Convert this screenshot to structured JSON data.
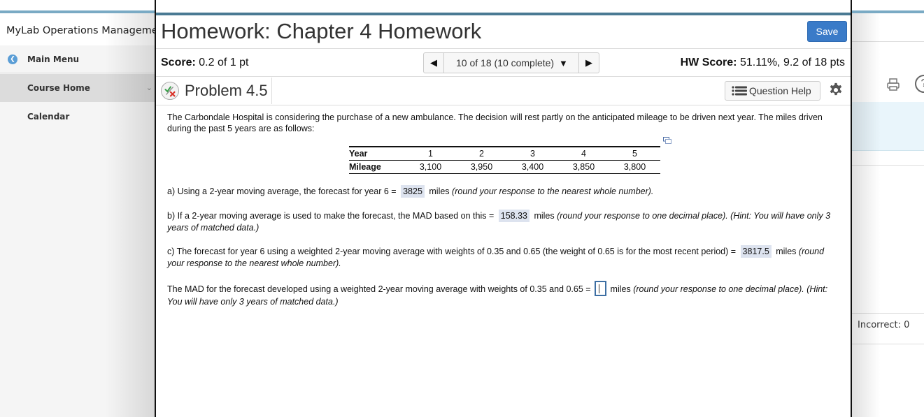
{
  "background": {
    "brand": "MyLab Operations Management",
    "sidebar": {
      "items": [
        {
          "label": "Main Menu",
          "icon": "back-circle-icon"
        },
        {
          "label": "Course Home",
          "icon": "chevron-down-icon"
        },
        {
          "label": "Calendar"
        }
      ]
    },
    "right_panel": {
      "incorrect_label": "Incorrect: 0",
      "icons": [
        "print-icon",
        "help-circle-icon"
      ]
    }
  },
  "modal": {
    "title": "Homework: Chapter 4 Homework",
    "save_label": "Save",
    "score_label": "Score:",
    "score_value": "0.2 of 1 pt",
    "nav": {
      "prev_icon": "◀",
      "current": "10 of 18 (10 complete)",
      "caret_icon": "▼",
      "next_icon": "▶"
    },
    "hw_score_label": "HW Score:",
    "hw_score_value": "51.11%, 9.2 of 18 pts",
    "problem_title": "Problem 4.5",
    "question_help_label": "Question Help",
    "colors": {
      "accent_bar": "#4a7a93",
      "save_button": "#3a7bc8",
      "answer_highlight": "#dde3ef"
    }
  },
  "question": {
    "intro": "The Carbondale Hospital is considering the purchase of a new ambulance. The decision will rest partly on the anticipated mileage to be driven next year. The miles driven during the past 5 years are as follows:",
    "table": {
      "row_headers": [
        "Year",
        "Mileage"
      ],
      "years": [
        "1",
        "2",
        "3",
        "4",
        "5"
      ],
      "mileage": [
        "3,100",
        "3,950",
        "3,400",
        "3,850",
        "3,800"
      ]
    },
    "part_a": {
      "prefix": "a) Using a 2-year moving average, the forecast for year 6 =",
      "answer": "3825",
      "unit": "miles",
      "hint": "(round your response to the nearest whole number)."
    },
    "part_b": {
      "prefix": "b) If a 2-year moving average is used to make the forecast, the MAD based on this =",
      "answer": "158.33",
      "unit": "miles",
      "hint": "(round your response to one decimal place).  (Hint: You will have only 3 years of matched data.)"
    },
    "part_c": {
      "prefix": "c) The forecast for year 6 using a weighted 2-year moving average with weights of 0.35 and 0.65 (the weight of 0.65 is for the most recent period) =",
      "answer": "3817.5",
      "unit": "miles",
      "hint": "(round your response to the nearest whole number)."
    },
    "part_d": {
      "prefix": "The MAD for the forecast developed using a weighted 2-year moving average with weights of 0.35 and 0.65 =",
      "answer": "",
      "unit": "miles",
      "hint": "(round your response to one decimal place). (Hint: You will have only 3 years of matched data.)"
    }
  }
}
